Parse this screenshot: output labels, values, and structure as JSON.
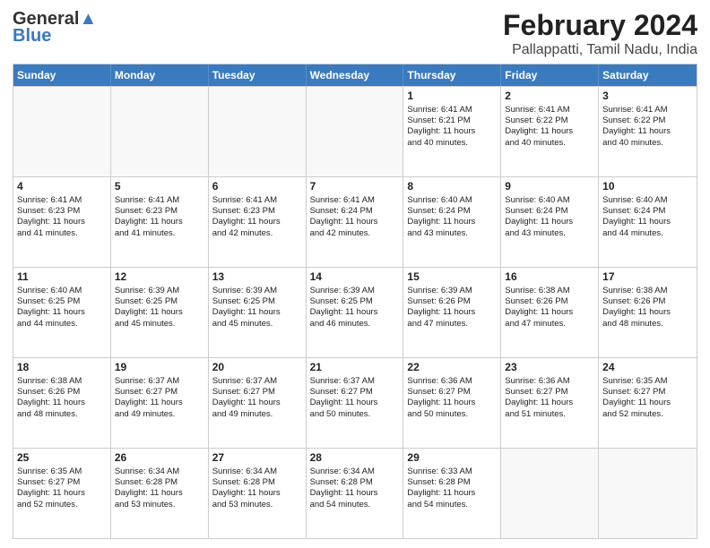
{
  "header": {
    "logo_general": "General",
    "logo_blue": "Blue",
    "title": "February 2024",
    "subtitle": "Pallappatti, Tamil Nadu, India"
  },
  "days": [
    "Sunday",
    "Monday",
    "Tuesday",
    "Wednesday",
    "Thursday",
    "Friday",
    "Saturday"
  ],
  "weeks": [
    [
      {
        "day": "",
        "info": ""
      },
      {
        "day": "",
        "info": ""
      },
      {
        "day": "",
        "info": ""
      },
      {
        "day": "",
        "info": ""
      },
      {
        "day": "1",
        "info": "Sunrise: 6:41 AM\nSunset: 6:21 PM\nDaylight: 11 hours\nand 40 minutes."
      },
      {
        "day": "2",
        "info": "Sunrise: 6:41 AM\nSunset: 6:22 PM\nDaylight: 11 hours\nand 40 minutes."
      },
      {
        "day": "3",
        "info": "Sunrise: 6:41 AM\nSunset: 6:22 PM\nDaylight: 11 hours\nand 40 minutes."
      }
    ],
    [
      {
        "day": "4",
        "info": "Sunrise: 6:41 AM\nSunset: 6:23 PM\nDaylight: 11 hours\nand 41 minutes."
      },
      {
        "day": "5",
        "info": "Sunrise: 6:41 AM\nSunset: 6:23 PM\nDaylight: 11 hours\nand 41 minutes."
      },
      {
        "day": "6",
        "info": "Sunrise: 6:41 AM\nSunset: 6:23 PM\nDaylight: 11 hours\nand 42 minutes."
      },
      {
        "day": "7",
        "info": "Sunrise: 6:41 AM\nSunset: 6:24 PM\nDaylight: 11 hours\nand 42 minutes."
      },
      {
        "day": "8",
        "info": "Sunrise: 6:40 AM\nSunset: 6:24 PM\nDaylight: 11 hours\nand 43 minutes."
      },
      {
        "day": "9",
        "info": "Sunrise: 6:40 AM\nSunset: 6:24 PM\nDaylight: 11 hours\nand 43 minutes."
      },
      {
        "day": "10",
        "info": "Sunrise: 6:40 AM\nSunset: 6:24 PM\nDaylight: 11 hours\nand 44 minutes."
      }
    ],
    [
      {
        "day": "11",
        "info": "Sunrise: 6:40 AM\nSunset: 6:25 PM\nDaylight: 11 hours\nand 44 minutes."
      },
      {
        "day": "12",
        "info": "Sunrise: 6:39 AM\nSunset: 6:25 PM\nDaylight: 11 hours\nand 45 minutes."
      },
      {
        "day": "13",
        "info": "Sunrise: 6:39 AM\nSunset: 6:25 PM\nDaylight: 11 hours\nand 45 minutes."
      },
      {
        "day": "14",
        "info": "Sunrise: 6:39 AM\nSunset: 6:25 PM\nDaylight: 11 hours\nand 46 minutes."
      },
      {
        "day": "15",
        "info": "Sunrise: 6:39 AM\nSunset: 6:26 PM\nDaylight: 11 hours\nand 47 minutes."
      },
      {
        "day": "16",
        "info": "Sunrise: 6:38 AM\nSunset: 6:26 PM\nDaylight: 11 hours\nand 47 minutes."
      },
      {
        "day": "17",
        "info": "Sunrise: 6:38 AM\nSunset: 6:26 PM\nDaylight: 11 hours\nand 48 minutes."
      }
    ],
    [
      {
        "day": "18",
        "info": "Sunrise: 6:38 AM\nSunset: 6:26 PM\nDaylight: 11 hours\nand 48 minutes."
      },
      {
        "day": "19",
        "info": "Sunrise: 6:37 AM\nSunset: 6:27 PM\nDaylight: 11 hours\nand 49 minutes."
      },
      {
        "day": "20",
        "info": "Sunrise: 6:37 AM\nSunset: 6:27 PM\nDaylight: 11 hours\nand 49 minutes."
      },
      {
        "day": "21",
        "info": "Sunrise: 6:37 AM\nSunset: 6:27 PM\nDaylight: 11 hours\nand 50 minutes."
      },
      {
        "day": "22",
        "info": "Sunrise: 6:36 AM\nSunset: 6:27 PM\nDaylight: 11 hours\nand 50 minutes."
      },
      {
        "day": "23",
        "info": "Sunrise: 6:36 AM\nSunset: 6:27 PM\nDaylight: 11 hours\nand 51 minutes."
      },
      {
        "day": "24",
        "info": "Sunrise: 6:35 AM\nSunset: 6:27 PM\nDaylight: 11 hours\nand 52 minutes."
      }
    ],
    [
      {
        "day": "25",
        "info": "Sunrise: 6:35 AM\nSunset: 6:27 PM\nDaylight: 11 hours\nand 52 minutes."
      },
      {
        "day": "26",
        "info": "Sunrise: 6:34 AM\nSunset: 6:28 PM\nDaylight: 11 hours\nand 53 minutes."
      },
      {
        "day": "27",
        "info": "Sunrise: 6:34 AM\nSunset: 6:28 PM\nDaylight: 11 hours\nand 53 minutes."
      },
      {
        "day": "28",
        "info": "Sunrise: 6:34 AM\nSunset: 6:28 PM\nDaylight: 11 hours\nand 54 minutes."
      },
      {
        "day": "29",
        "info": "Sunrise: 6:33 AM\nSunset: 6:28 PM\nDaylight: 11 hours\nand 54 minutes."
      },
      {
        "day": "",
        "info": ""
      },
      {
        "day": "",
        "info": ""
      }
    ]
  ]
}
